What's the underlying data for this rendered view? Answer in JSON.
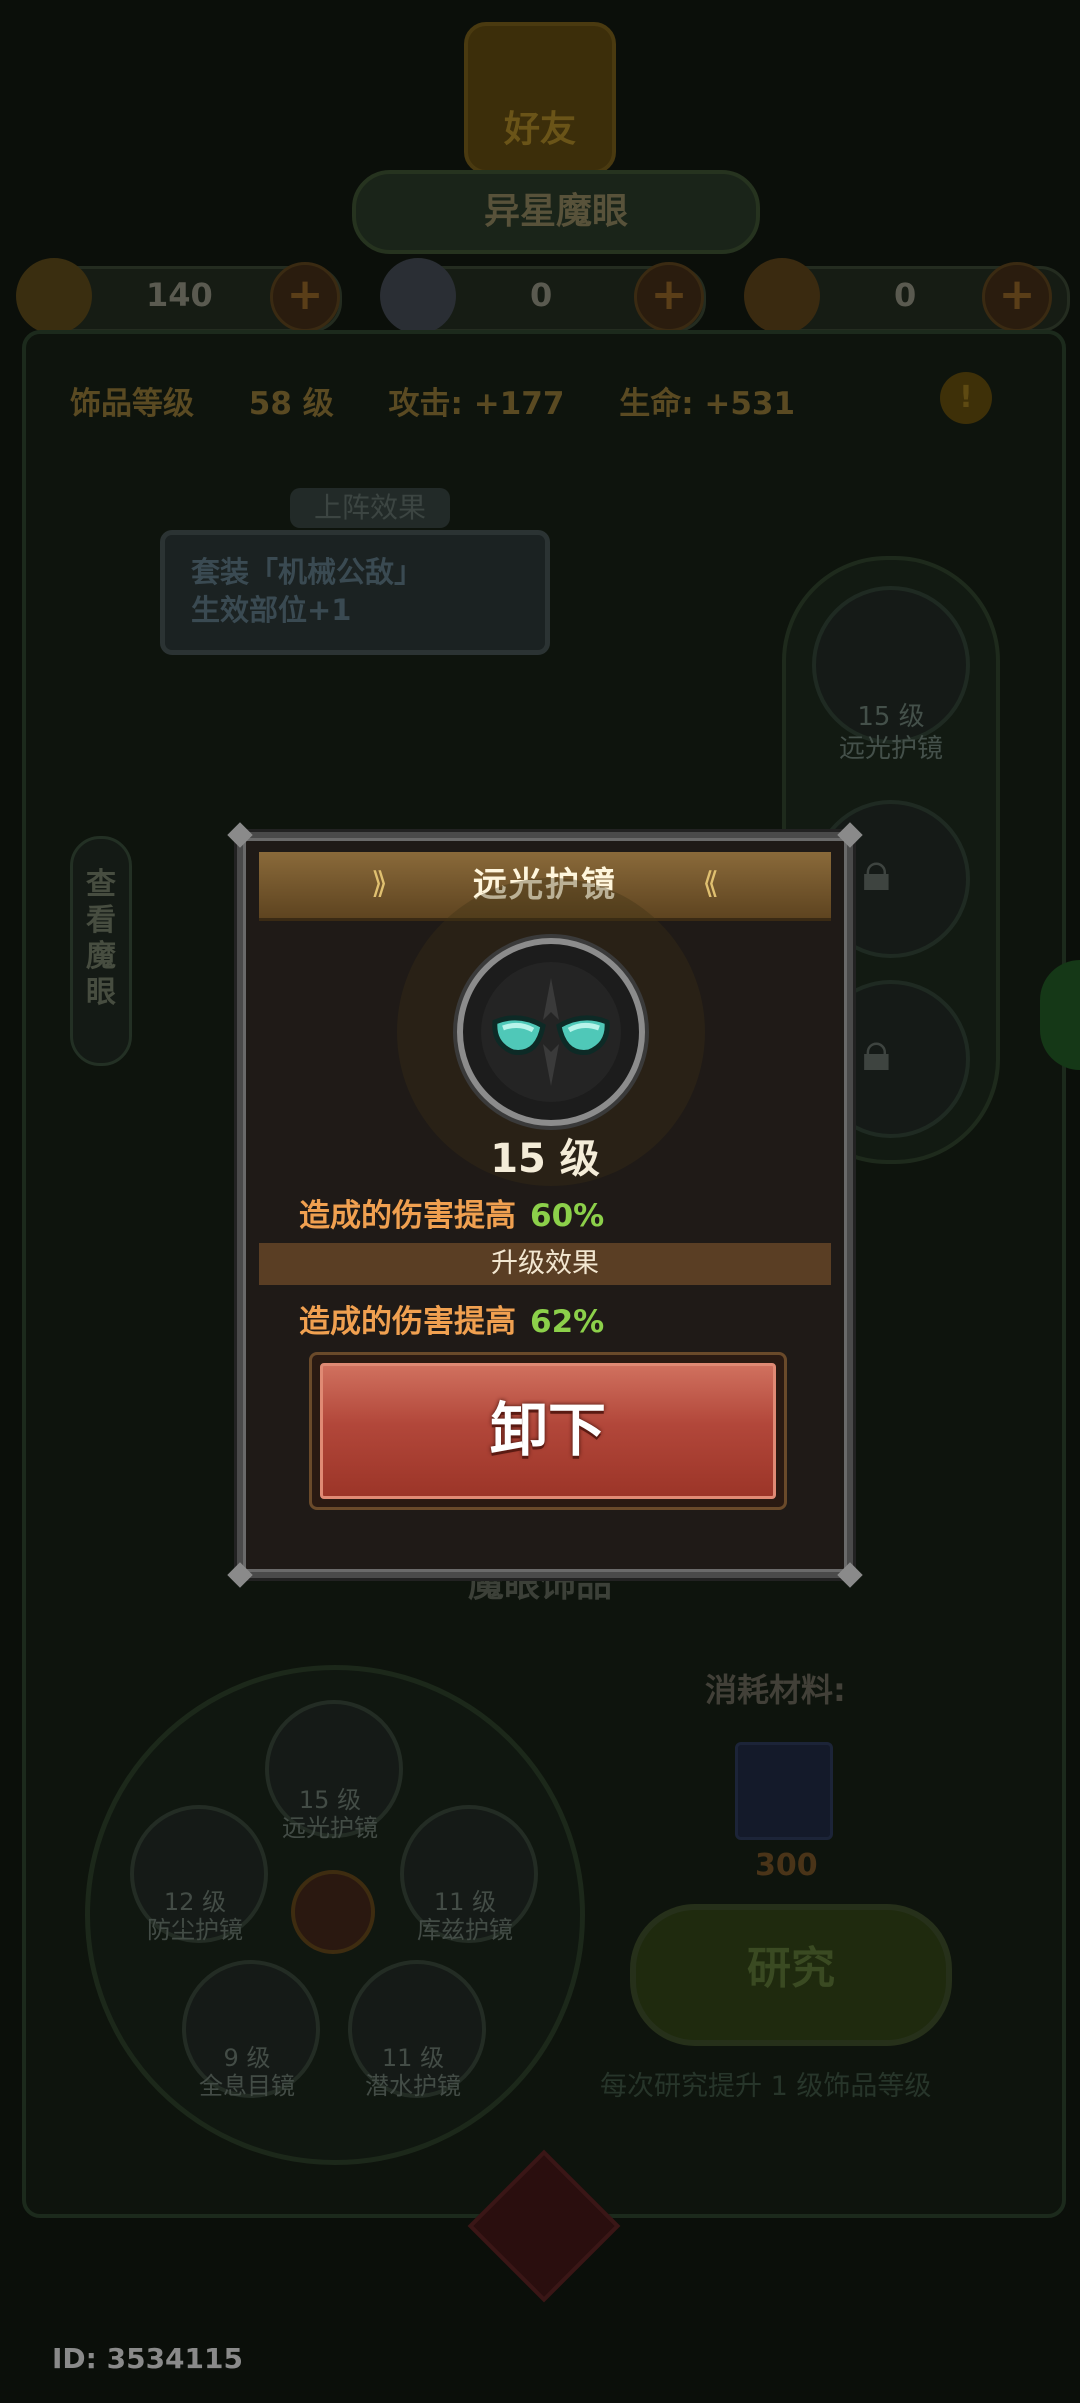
{
  "background": {
    "friends_button": "好友",
    "title": "异星魔眼",
    "resources": [
      {
        "icon": "gold-ore-icon",
        "value": "140"
      },
      {
        "icon": "silver-ore-icon",
        "value": "0"
      },
      {
        "icon": "gem-ore-icon",
        "value": "0"
      }
    ],
    "stats": {
      "level_label": "饰品等级",
      "level_value": "58 级",
      "attack": "攻击: +177",
      "hp": "生命: +531"
    },
    "deploy_effect": {
      "tag": "上阵效果",
      "line1": "套装「机械公敌」",
      "line2": "生效部位+1"
    },
    "side_tab": "查看魔眼",
    "slots": {
      "slot1_level": "15 级",
      "slot1_name": "远光护镜"
    },
    "section_title": "魔眼饰品",
    "wheel": [
      {
        "level": "15 级",
        "name": "远光护镜"
      },
      {
        "level": "12 级",
        "name": "防尘护镜"
      },
      {
        "level": "11 级",
        "name": "库兹护镜"
      },
      {
        "level": "9 级",
        "name": "全息目镜"
      },
      {
        "level": "11 级",
        "name": "潜水护镜"
      }
    ],
    "materials_label": "消耗材料:",
    "material_count": "300",
    "research_button": "研究",
    "research_note": "每次研究提升 1 级饰品等级",
    "player_id": "ID: 3534115"
  },
  "modal": {
    "title": "远光护镜",
    "level": "15 级",
    "current_effect": {
      "text": "造成的伤害提高",
      "value": "60%"
    },
    "upgrade_label": "升级效果",
    "next_effect": {
      "text": "造成的伤害提高",
      "value": "62%"
    },
    "unequip_button": "卸下"
  },
  "colors": {
    "modal_bg": "#1f1a17",
    "header_gold": "#8a6a3a",
    "effect_orange": "#f0a050",
    "percent_green": "#8cd04a",
    "button_red": "#b2473a"
  }
}
